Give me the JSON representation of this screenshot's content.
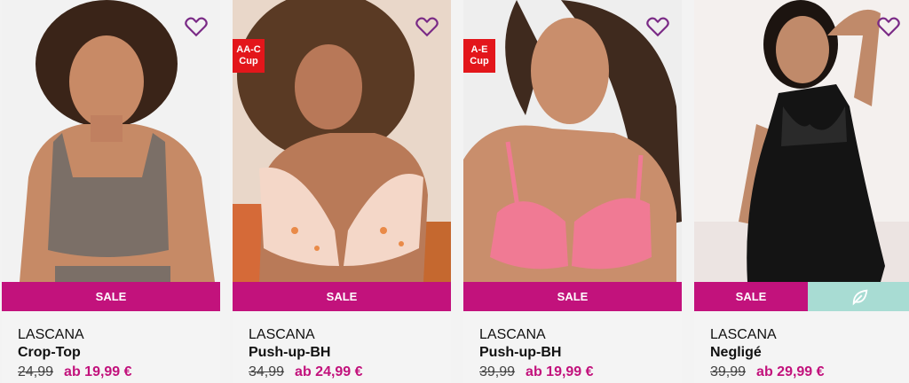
{
  "products": [
    {
      "brand": "LASCANA",
      "name": "Crop-Top",
      "badge": "",
      "sale_label": "SALE",
      "old_price": "24,99",
      "new_price": "ab 19,99 €",
      "image": "model wearing taupe crop top",
      "colors": {
        "garment": "#7b6f67",
        "bg": "#f2f2f2"
      }
    },
    {
      "brand": "LASCANA",
      "name": "Push-up-BH",
      "badge": "AA-C Cup",
      "badge_lines": [
        "AA-C",
        "Cup"
      ],
      "sale_label": "SALE",
      "old_price": "34,99",
      "new_price": "ab 24,99 €",
      "image": "model wearing floral push-up bra",
      "colors": {
        "garment": "#f4d7c8",
        "bg": "#d56a38"
      }
    },
    {
      "brand": "LASCANA",
      "name": "Push-up-BH",
      "badge": "A-E Cup",
      "badge_lines": [
        "A-E",
        "Cup"
      ],
      "sale_label": "SALE",
      "old_price": "39,99",
      "new_price": "ab 19,99 €",
      "image": "model wearing pink lace push-up bra",
      "colors": {
        "garment": "#f07a94",
        "bg": "#eeeeee"
      }
    },
    {
      "brand": "LASCANA",
      "name": "Negligé",
      "badge": "",
      "sale_label": "SALE",
      "old_price": "39,99",
      "new_price": "ab 29,99 €",
      "image": "model wearing black lace negligee",
      "eco_icon": "leaf-icon",
      "colors": {
        "garment": "#141414",
        "bg": "#f4f0ee"
      }
    }
  ],
  "accent": "#c2127c",
  "eco_color": "#a8dcd3",
  "badge_color": "#e3161b",
  "heart_color": "#7a2a86"
}
